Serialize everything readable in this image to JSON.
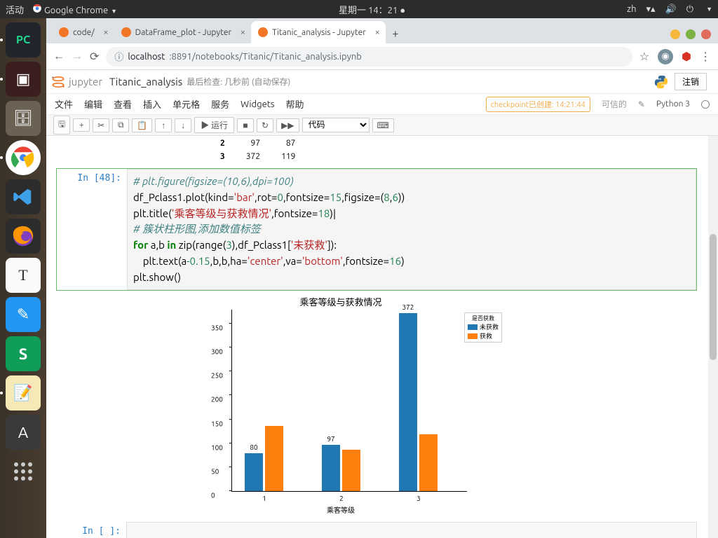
{
  "gnome": {
    "activities": "活动",
    "app": "Google Chrome",
    "clock": "星期一 14：21",
    "lang": "zh"
  },
  "tabs": {
    "t1": "code/",
    "t2": "DataFrame_plot - Jupyter",
    "t3": "Titanic_analysis - Jupyter"
  },
  "addr": {
    "info": "ⓘ",
    "host": "localhost",
    "rest": ":8891/notebooks/Titanic/Titanic_analysis.ipynb"
  },
  "jup": {
    "brand": "jupyter",
    "title": "Titanic_analysis",
    "saved": "最后检查: 几秒前 (自动保存)",
    "logout": "注销",
    "menu": {
      "file": "文件",
      "edit": "编辑",
      "view": "查看",
      "insert": "插入",
      "cell": "单元格",
      "services": "服务",
      "widgets": "Widgets",
      "help": "帮助"
    },
    "checkpoint": "checkpoint已创建: 14:21:44",
    "trusted": "可信的",
    "kernel": "Python 3",
    "run": "▶ 运行",
    "celltype": "代码"
  },
  "table": {
    "r2": {
      "idx": "2",
      "a": "97",
      "b": "87"
    },
    "r3": {
      "idx": "3",
      "a": "372",
      "b": "119"
    }
  },
  "prompt48": "In [48]:",
  "promptEmpty": "In [ ]:",
  "code": {
    "l1": "# plt.figure(figsize=(10,6),dpi=100)",
    "l2a": "df_Pclass1.plot(kind=",
    "l2b": "'bar'",
    "l2c": ",rot=",
    "l2d": "0",
    "l2e": ",fontsize=",
    "l2f": "15",
    "l2g": ",figsize=(",
    "l2h": "8",
    "l2i": ",",
    "l2j": "6",
    "l2k": "))",
    "l3a": "plt.title(",
    "l3b": "'乘客等级与获救情况'",
    "l3c": ",fontsize=",
    "l3d": "18",
    "l3e": ")|",
    "l4": "# 簇状柱形图,添加数值标签",
    "l5a": "for",
    "l5b": " a,b ",
    "l5c": "in",
    "l5d": " zip(range(",
    "l5e": "3",
    "l5f": "),df_Pclass1[",
    "l5g": "'未获救'",
    "l5h": "]):",
    "l6a": "    plt.text(a",
    "l6b": "-0.15",
    "l6c": ",b,b,ha=",
    "l6d": "'center'",
    "l6e": ",va=",
    "l6f": "'bottom'",
    "l6g": ",fontsize=",
    "l6h": "16",
    "l6i": ")",
    "l7": "plt.show()"
  },
  "chart_data": {
    "type": "bar",
    "title": "乘客等级与获救情况",
    "xlabel": "乘客等级",
    "ylabel": "",
    "categories": [
      "1",
      "2",
      "3"
    ],
    "series": [
      {
        "name": "未获救",
        "values": [
          80,
          97,
          372
        ],
        "color": "#1f77b4"
      },
      {
        "name": "获救",
        "values": [
          136,
          87,
          119
        ],
        "color": "#ff7f0e"
      }
    ],
    "ylim": [
      0,
      380
    ],
    "yticks": [
      0,
      50,
      100,
      150,
      200,
      250,
      300,
      350
    ],
    "legend_title": "是否获救",
    "bar_labels": [
      80,
      97,
      372
    ]
  }
}
